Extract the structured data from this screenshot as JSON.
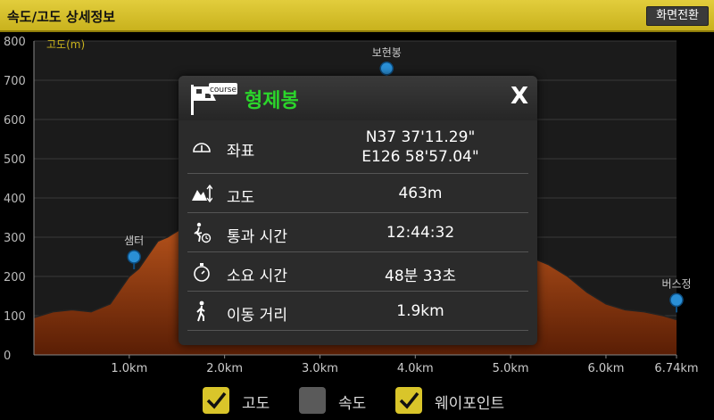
{
  "header": {
    "title": "속도/고도 상세정보",
    "switch_label": "화면전환"
  },
  "chart_data": {
    "type": "area",
    "ylabel": "고도(m)",
    "y_ticks": [
      "800",
      "700",
      "600",
      "500",
      "400",
      "300",
      "200",
      "100",
      "0"
    ],
    "ylim": [
      0,
      800
    ],
    "xlim": [
      0,
      6.74
    ],
    "x_ticks": [
      "1.0km",
      "2.0km",
      "3.0km",
      "4.0km",
      "5.0km",
      "6.0km",
      "6.74km"
    ],
    "x_tick_values": [
      1.0,
      2.0,
      3.0,
      4.0,
      5.0,
      6.0,
      6.74
    ],
    "x": [
      0,
      0.2,
      0.4,
      0.6,
      0.8,
      1.0,
      1.1,
      1.2,
      1.3,
      1.4,
      1.6,
      4.8,
      5.0,
      5.2,
      5.4,
      5.6,
      5.8,
      6.0,
      6.2,
      6.4,
      6.6,
      6.74
    ],
    "y": [
      95,
      110,
      115,
      110,
      130,
      200,
      220,
      255,
      290,
      300,
      330,
      320,
      280,
      250,
      230,
      200,
      160,
      130,
      115,
      110,
      100,
      90
    ],
    "series": [
      {
        "name": "고도",
        "color": "#b5521b"
      }
    ],
    "waypoints": [
      {
        "name": "샘터",
        "x": 1.05,
        "y": 250
      },
      {
        "name": "보현봉",
        "x": 3.7,
        "y": 730
      },
      {
        "name": "버스정",
        "x": 6.74,
        "y": 140
      }
    ]
  },
  "popup": {
    "title": "형제봉",
    "close_label": "X",
    "rows": [
      {
        "icon": "coordinate-icon",
        "label": "좌표",
        "value_line1": "N37 37'11.29\"",
        "value_line2": "E126 58'57.04\""
      },
      {
        "icon": "altitude-icon",
        "label": "고도",
        "value": "463m"
      },
      {
        "icon": "hiker-time-icon",
        "label": "통과 시간",
        "value": "12:44:32"
      },
      {
        "icon": "stopwatch-icon",
        "label": "소요 시간",
        "value": "48분 33초"
      },
      {
        "icon": "walker-icon",
        "label": "이동 거리",
        "value": "1.9km"
      }
    ]
  },
  "legend": [
    {
      "label": "고도",
      "checked": true
    },
    {
      "label": "속도",
      "checked": false
    },
    {
      "label": "웨이포인트",
      "checked": true
    }
  ],
  "colors": {
    "accent": "#d9c52a",
    "area": "#b5521b",
    "title_green": "#2bd52b"
  }
}
